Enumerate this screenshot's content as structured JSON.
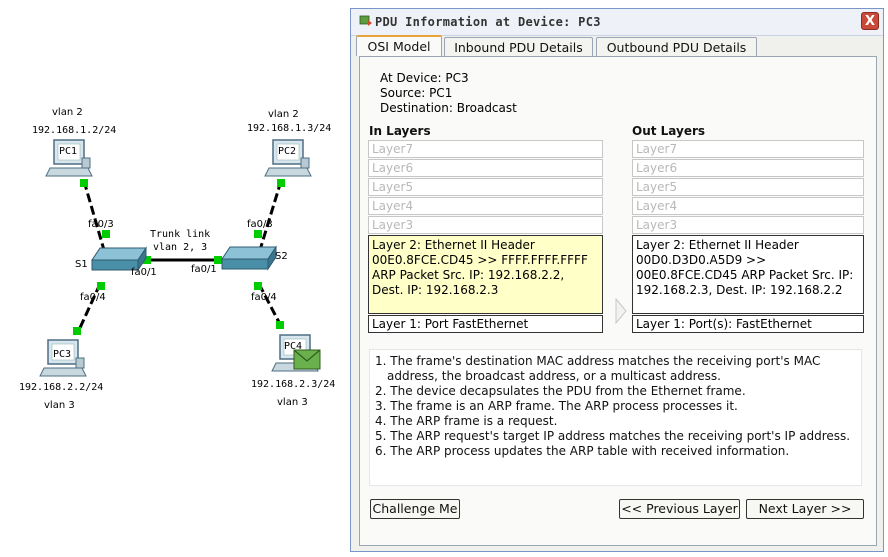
{
  "topology": {
    "pc1": {
      "name": "PC1",
      "vlan": "vlan 2",
      "ip": "192.168.1.2/24",
      "port": "fa0/3"
    },
    "pc2": {
      "name": "PC2",
      "vlan": "vlan 2",
      "ip": "192.168.1.3/24",
      "port": "fa0/3"
    },
    "pc3": {
      "name": "PC3",
      "vlan": "vlan 3",
      "ip": "192.168.2.2/24",
      "port": "fa0/4"
    },
    "pc4": {
      "name": "PC4",
      "vlan": "vlan 3",
      "ip": "192.168.2.3/24",
      "port": "fa0/4"
    },
    "s1": {
      "name": "S1",
      "trunk_port": "fa0/1"
    },
    "s2": {
      "name": "S2",
      "trunk_port": "fa0/1"
    },
    "trunk": {
      "line1": "Trunk link",
      "line2": "vlan 2, 3"
    },
    "colors": {
      "link": "#000000",
      "link_up": "#00cc00",
      "switch": "#4a8fa8",
      "envelope": "#6ab04c"
    }
  },
  "dialog": {
    "title": "PDU Information at Device: PC3",
    "close_label": "X",
    "tabs": [
      "OSI Model",
      "Inbound PDU Details",
      "Outbound PDU Details"
    ],
    "active_tab": "OSI Model",
    "device_line": "At Device: PC3",
    "source_line": "Source: PC1",
    "destination_line": "Destination: Broadcast",
    "in_layers": {
      "heading": "In Layers",
      "inactive": [
        "Layer7",
        "Layer6",
        "Layer5",
        "Layer4",
        "Layer3"
      ],
      "layer2": "Layer 2: Ethernet II Header 00E0.8FCE.CD45 >> FFFF.FFFF.FFFF ARP Packet Src. IP: 192.168.2.2, Dest. IP: 192.168.2.3",
      "layer1": "Layer 1: Port FastEthernet"
    },
    "out_layers": {
      "heading": "Out Layers",
      "inactive": [
        "Layer7",
        "Layer6",
        "Layer5",
        "Layer4",
        "Layer3"
      ],
      "layer2": "Layer 2: Ethernet II Header 00D0.D3D0.A5D9 >> 00E0.8FCE.CD45 ARP Packet Src. IP: 192.168.2.3, Dest. IP: 192.168.2.2",
      "layer1": "Layer 1: Port(s): FastEthernet"
    },
    "steps": [
      "1. The frame's destination MAC address matches the receiving port's MAC address, the broadcast address, or a multicast address.",
      "2. The device decapsulates the PDU from the Ethernet frame.",
      "3. The frame is an ARP frame. The ARP process processes it.",
      "4. The ARP frame is a request.",
      "5. The ARP request's target IP address matches the receiving port's IP address.",
      "6. The ARP process updates the ARP table with received information."
    ],
    "buttons": {
      "challenge": "Challenge Me",
      "previous": "<< Previous Layer",
      "next": "Next Layer >>"
    },
    "colors": {
      "selected_layer_bg": "#ffffc8",
      "tab_highlight": "#e8a33a",
      "close_bg": "#c94a3a"
    }
  }
}
